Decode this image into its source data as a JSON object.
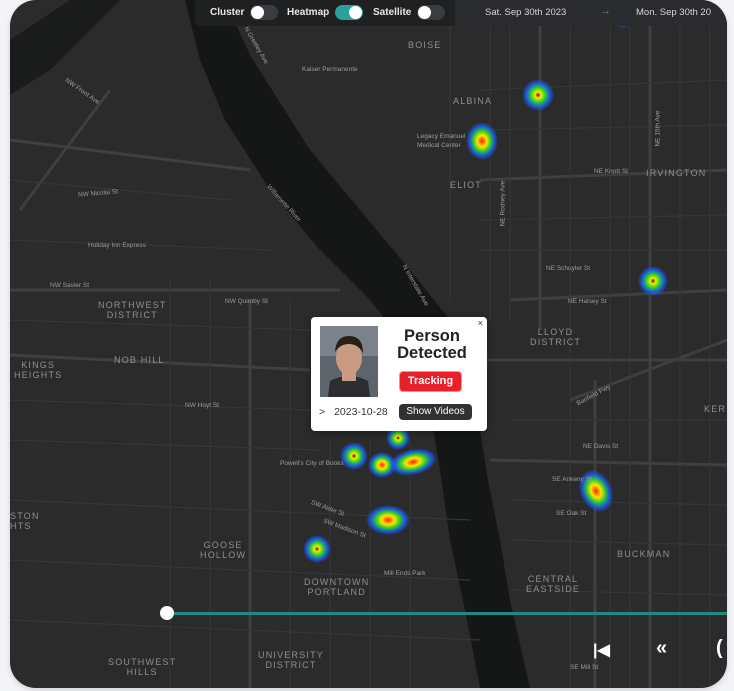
{
  "toolbar": {
    "cluster_label": "Cluster",
    "cluster_on": false,
    "heatmap_label": "Heatmap",
    "heatmap_on": true,
    "satellite_label": "Satellite",
    "satellite_on": false,
    "start_date": "Sat. Sep 30th 2023",
    "end_date": "Mon. Sep 30th 20",
    "arrow_glyph": "→"
  },
  "map": {
    "area_labels": [
      "BOISE",
      "ALBINA",
      "ELIOT",
      "IRVINGTON",
      "NORTHWEST\nDISTRICT",
      "NOB HILL",
      "KINGS\nHEIGHTS",
      "LLOYD\nDISTRICT",
      "DOWNTOWN\nPORTLAND",
      "GOOSE\nHOLLOW",
      "BUCKMAN",
      "CENTRAL\nEASTSIDE",
      "SOUTHWEST\nHILLS",
      "UNIVERSITY\nDISTRICT",
      "STON\nHTS",
      "KER"
    ],
    "street_labels": [
      "NW Front Ave",
      "NW Nicolai St",
      "Holiday Inn Express",
      "NW Savier St",
      "NW Quimby St",
      "NW Hoyt St",
      "Kaiser Permanente",
      "Legacy Emanuel Medical Center",
      "NE Knott St",
      "NE Schuyler St",
      "NE Halsey St",
      "NE Davis St",
      "Powell's City of Books",
      "SW Alder St",
      "SW Madison St",
      "Mill Ends Park",
      "NE Rodney Ave",
      "Banfield Fwy",
      "N Interstate Ave",
      "N Greeley Ave",
      "SE Ankeny St",
      "SE Oak St",
      "SE Mill St",
      "NE 15th Ave",
      "Willamette River"
    ],
    "heat_spots": [
      "heatspot",
      "heatspot",
      "heatspot",
      "heatspot",
      "heatspot",
      "heatspot",
      "heatspot",
      "heatspot",
      "heatspot",
      "heatspot",
      "heatspot"
    ]
  },
  "popup": {
    "title": "Person Detected",
    "status": "Tracking",
    "date": "2023-10-28",
    "expand_glyph": ">",
    "show_videos": "Show Videos",
    "close_glyph": "×"
  },
  "playback": {
    "skip_start_glyph": "|◀",
    "rewind_glyph": "«",
    "more_glyph": "("
  },
  "colors": {
    "accent": "#2aa198",
    "badge": "#e8202a",
    "map_bg": "#2b2b2c"
  }
}
